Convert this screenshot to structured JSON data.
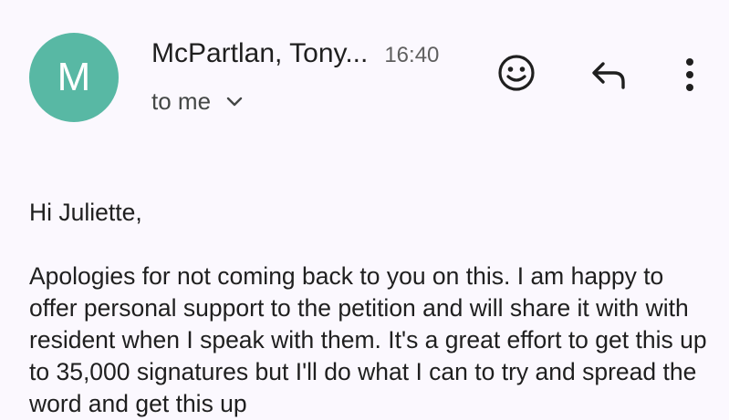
{
  "avatar": {
    "letter": "M",
    "color": "#58b8a4"
  },
  "header": {
    "sender": "McPartlan, Tony...",
    "time": "16:40",
    "recipient": "to me"
  },
  "actions": {
    "emoji_icon": "add-reaction-icon",
    "reply_icon": "reply-icon",
    "more_icon": "more-vert-icon"
  },
  "body": {
    "greeting": "Hi Juliette,",
    "paragraph": "Apologies for not coming back to you on this. I am happy to offer personal support to the petition and will share it with with resident when I speak with them. It's a great effort to get this up to 35,000 signatures but I'll do what I can to try and spread the word and get this up"
  },
  "colors": {
    "background": "#fbf8fe",
    "text": "#1f1f1f",
    "secondary_text": "#444746"
  }
}
